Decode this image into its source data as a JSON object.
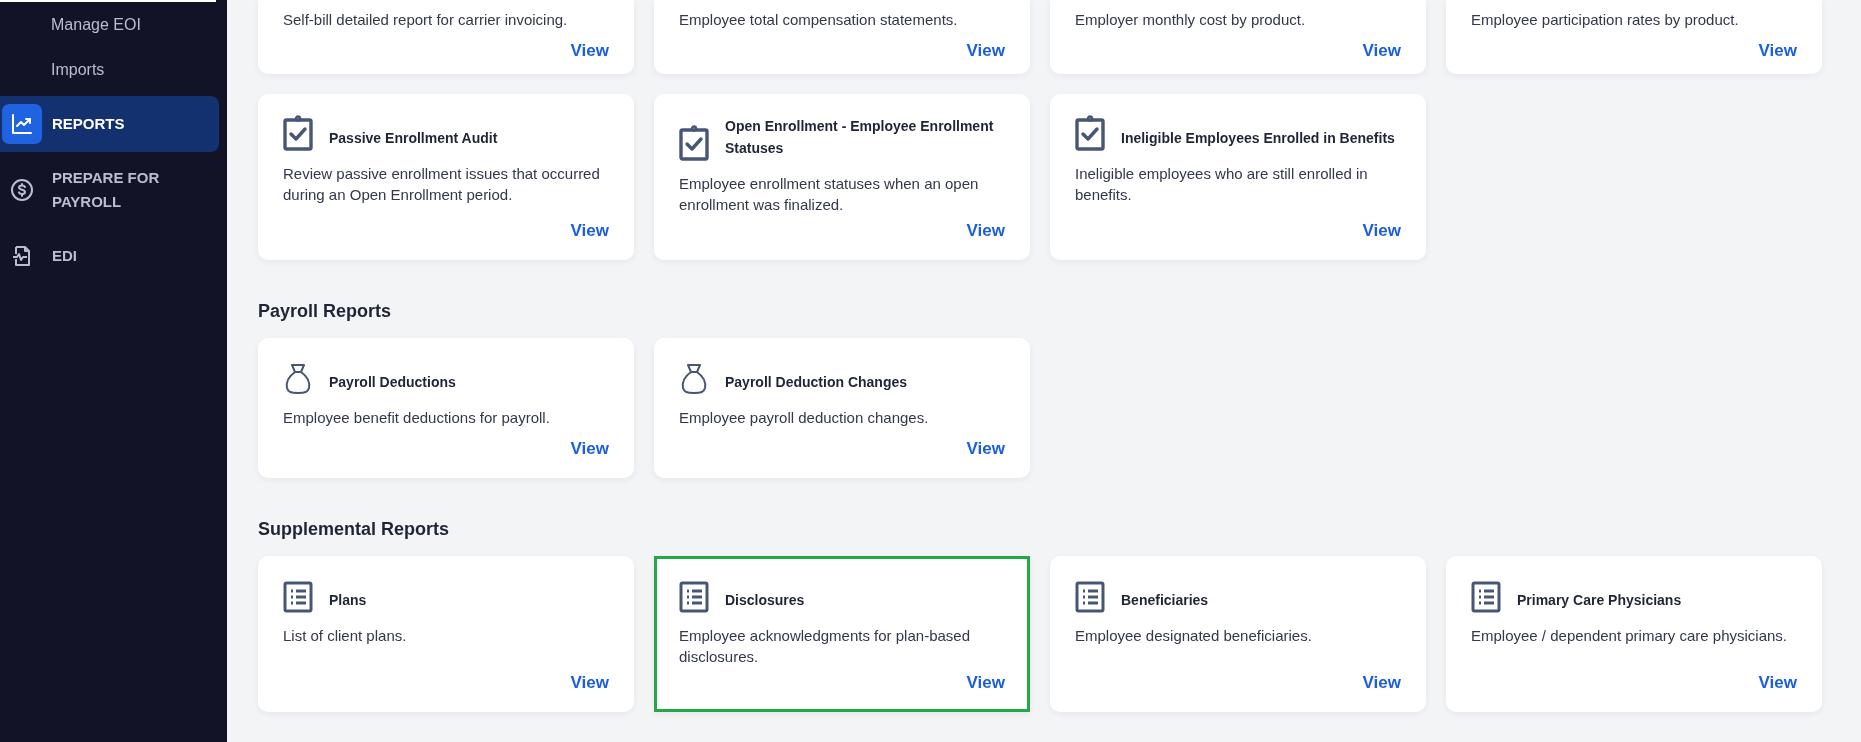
{
  "sidebar": {
    "items": [
      {
        "label": "Manage EOI",
        "kind": "sub",
        "selected": false
      },
      {
        "label": "Imports",
        "kind": "sub",
        "selected": false
      },
      {
        "label": "REPORTS",
        "kind": "chart",
        "selected": true
      },
      {
        "label": "PREPARE FOR PAYROLL",
        "kind": "money",
        "selected": false
      },
      {
        "label": "EDI",
        "kind": "file",
        "selected": false
      }
    ]
  },
  "sections": [
    {
      "kind": "checklist",
      "cards": [
        {
          "description": "Self-bill detailed report for carrier invoicing.",
          "link": "View",
          "highlighted": false
        },
        {
          "description": "Employee total compensation statements.",
          "link": "View",
          "highlighted": false
        },
        {
          "description": "Employer monthly cost by product.",
          "link": "View",
          "highlighted": false
        },
        {
          "description": "Employee participation rates by product.",
          "link": "View",
          "highlighted": false
        },
        {
          "title": "Passive Enrollment Audit",
          "description": "Review passive enrollment issues that occurred during an Open Enrollment period.",
          "link": "View",
          "highlighted": false
        },
        {
          "title": "Open Enrollment - Employee Enrollment Statuses",
          "description": "Employee enrollment statuses when an open enrollment was finalized.",
          "link": "View",
          "highlighted": false
        },
        {
          "title": "Ineligible Employees Enrolled in Benefits",
          "description": "Ineligible employees who are still enrolled in benefits.",
          "link": "View",
          "highlighted": false
        }
      ]
    },
    {
      "title": "Payroll Reports",
      "kind": "payroll",
      "cards": [
        {
          "title": "Payroll Deductions",
          "description": "Employee benefit deductions for payroll.",
          "link": "View",
          "highlighted": false
        },
        {
          "title": "Payroll Deduction Changes",
          "description": "Employee payroll deduction changes.",
          "link": "View",
          "highlighted": false
        }
      ]
    },
    {
      "title": "Supplemental Reports",
      "kind": "listing",
      "cards": [
        {
          "title": "Plans",
          "description": "List of client plans.",
          "link": "View",
          "highlighted": false
        },
        {
          "title": "Disclosures",
          "description": "Employee acknowledgments for plan-based disclosures.",
          "link": "View",
          "highlighted": true
        },
        {
          "title": "Beneficiaries",
          "description": "Employee designated beneficiaries.",
          "link": "View",
          "highlighted": false
        },
        {
          "title": "Primary Care Physicians",
          "description": "Employee / dependent primary care physicians.",
          "link": "View",
          "highlighted": false
        }
      ]
    }
  ]
}
